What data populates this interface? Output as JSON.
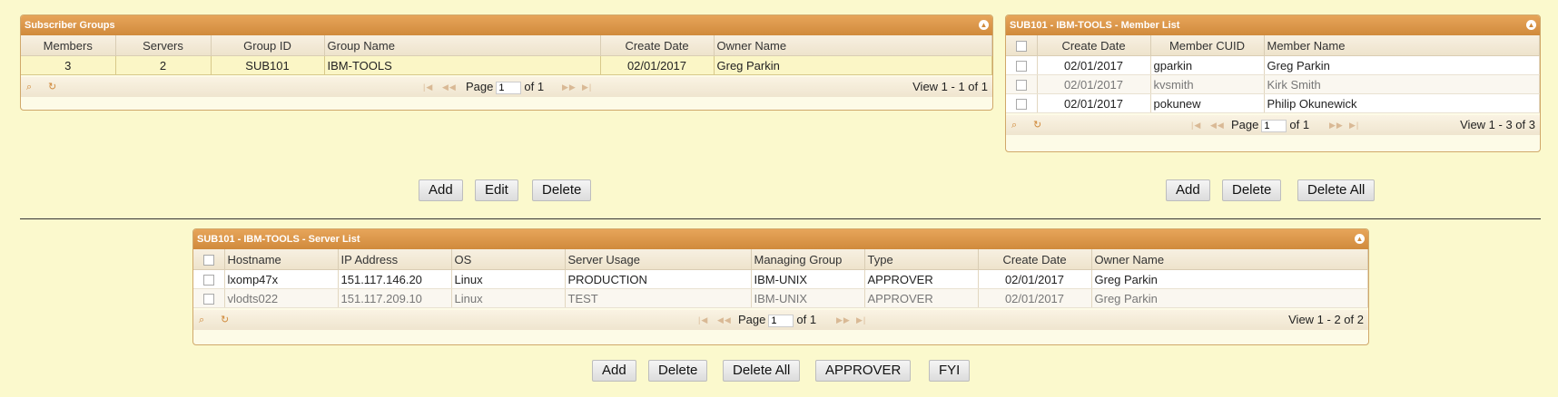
{
  "subscriber_groups": {
    "title": "Subscriber Groups",
    "columns": [
      "Members",
      "Servers",
      "Group ID",
      "Group Name",
      "Create Date",
      "Owner Name"
    ],
    "rows": [
      {
        "members": "3",
        "servers": "2",
        "group_id": "SUB101",
        "group_name": "IBM-TOOLS",
        "create_date": "02/01/2017",
        "owner_name": "Greg Parkin"
      }
    ],
    "pager": {
      "page_label": "Page",
      "page_value": "1",
      "of_label": "of 1",
      "view": "View 1 - 1 of 1"
    },
    "buttons": {
      "add": "Add",
      "edit": "Edit",
      "delete": "Delete"
    }
  },
  "member_list": {
    "title": "SUB101 - IBM-TOOLS - Member List",
    "columns": [
      "Create Date",
      "Member CUID",
      "Member Name"
    ],
    "rows": [
      {
        "create_date": "02/01/2017",
        "cuid": "gparkin",
        "name": "Greg Parkin"
      },
      {
        "create_date": "02/01/2017",
        "cuid": "kvsmith",
        "name": "Kirk Smith"
      },
      {
        "create_date": "02/01/2017",
        "cuid": "pokunew",
        "name": "Philip Okunewick"
      }
    ],
    "pager": {
      "page_label": "Page",
      "page_value": "1",
      "of_label": "of 1",
      "view": "View 1 - 3 of 3"
    },
    "buttons": {
      "add": "Add",
      "delete": "Delete",
      "delete_all": "Delete All"
    }
  },
  "server_list": {
    "title": "SUB101 - IBM-TOOLS - Server List",
    "columns": [
      "Hostname",
      "IP Address",
      "OS",
      "Server Usage",
      "Managing Group",
      "Type",
      "Create Date",
      "Owner Name"
    ],
    "rows": [
      {
        "hostname": "lxomp47x",
        "ip": "151.117.146.20",
        "os": "Linux",
        "usage": "PRODUCTION",
        "managing_group": "IBM-UNIX",
        "type": "APPROVER",
        "create_date": "02/01/2017",
        "owner_name": "Greg Parkin"
      },
      {
        "hostname": "vlodts022",
        "ip": "151.117.209.10",
        "os": "Linux",
        "usage": "TEST",
        "managing_group": "IBM-UNIX",
        "type": "APPROVER",
        "create_date": "02/01/2017",
        "owner_name": "Greg Parkin"
      }
    ],
    "pager": {
      "page_label": "Page",
      "page_value": "1",
      "of_label": "of 1",
      "view": "View 1 - 2 of 2"
    },
    "buttons": {
      "add": "Add",
      "delete": "Delete",
      "delete_all": "Delete All",
      "approver": "APPROVER",
      "fyi": "FYI"
    }
  },
  "icons": {
    "search": "search-icon",
    "refresh": "refresh-icon",
    "collapse": "collapse-icon",
    "first": "first-page-icon",
    "prev": "prev-page-icon",
    "next": "next-page-icon",
    "last": "last-page-icon"
  },
  "colors": {
    "page_bg": "#fbf9cd",
    "title_bar": "#d08a3c",
    "selected_row": "#fbf6c6"
  }
}
